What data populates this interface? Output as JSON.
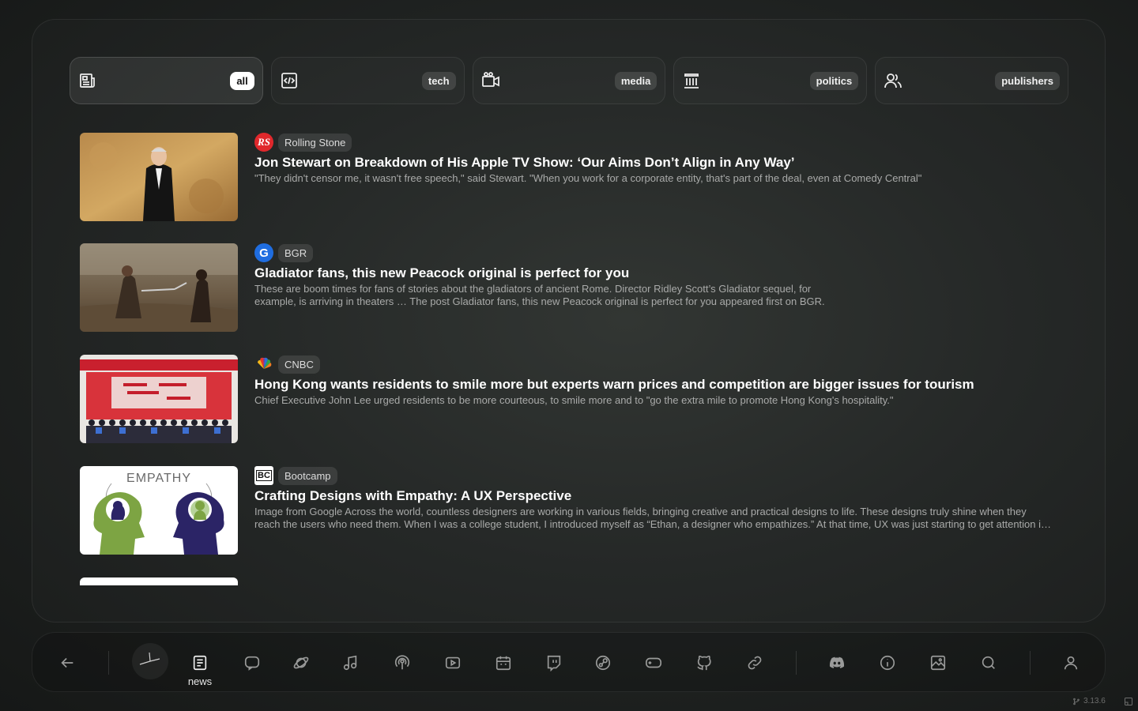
{
  "tabs": [
    {
      "label": "all",
      "icon": "newspaper-icon",
      "active": true
    },
    {
      "label": "tech",
      "icon": "code-file-icon",
      "active": false
    },
    {
      "label": "media",
      "icon": "video-camera-icon",
      "active": false
    },
    {
      "label": "politics",
      "icon": "building-columns-icon",
      "active": false
    },
    {
      "label": "publishers",
      "icon": "users-icon",
      "active": false
    }
  ],
  "articles": [
    {
      "source": "Rolling Stone",
      "source_icon": "RS",
      "title": "Jon Stewart on Breakdown of His Apple TV Show: ‘Our Aims Don’t Align in Any Way’",
      "description": "\"They didn't censor me, it wasn't free speech,\" said Stewart. \"When you work for a corporate entity, that's part of the deal, even at Comedy Central\""
    },
    {
      "source": "BGR",
      "source_icon": "G",
      "title": "Gladiator fans, this new Peacock original is perfect for you",
      "description": "These are boom times for fans of stories about the gladiators of ancient Rome. Director Ridley Scott’s Gladiator sequel, for example, is arriving in theaters … The post Gladiator fans, this new Peacock original is perfect for you appeared first on BGR."
    },
    {
      "source": "CNBC",
      "source_icon": "peacock-logo-icon",
      "title": "Hong Kong wants residents to smile more but experts warn prices and competition are bigger issues for tourism",
      "description": "Chief Executive John Lee urged residents to be more courteous, to smile more and to \"go the extra mile to promote Hong Kong's hospitality.\""
    },
    {
      "source": "Bootcamp",
      "source_icon": "BC",
      "title": "Crafting Designs with Empathy: A UX Perspective",
      "description": "Image from Google Across the world, countless designers are working in various fields, bringing creative and practical designs to life. These designs truly shine when they reach the users who need them. When I was a college student, I introduced myself as “Ethan, a designer who empathizes.” At that time, UX was just starting to get attention in Korea and many people did not understand what it meant.",
      "thumb_text": "EMPATHY"
    }
  ],
  "dock": {
    "active_label": "news",
    "items": [
      "back-arrow-icon",
      "clock-icon",
      "newspaper-icon",
      "chat-bubble-icon",
      "planet-icon",
      "music-note-icon",
      "podcast-icon",
      "play-video-icon",
      "calendar-icon",
      "twitch-icon",
      "steam-icon",
      "gamepad-icon",
      "github-icon",
      "link-icon",
      "discord-icon",
      "info-icon",
      "image-icon",
      "search-icon",
      "user-icon"
    ]
  },
  "version": "3.13.6",
  "colors": {
    "accent": "#ffffff",
    "muted": "#a9aaa9"
  }
}
